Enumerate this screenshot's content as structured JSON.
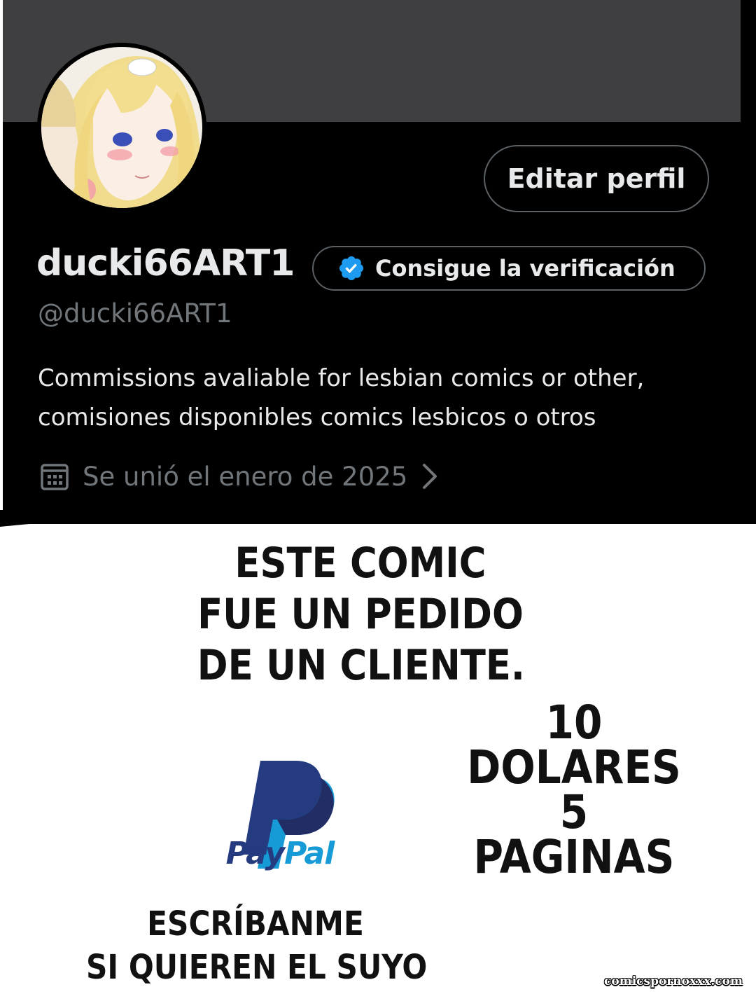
{
  "profile": {
    "display_name": "ducki66ART1",
    "handle": "@ducki66ART1",
    "edit_profile_label": "Editar perfil",
    "verification_label": "Consigue la verificación",
    "bio_lines": [
      "Commissions avaliable for lesbian comics or other,",
      "comisiones disponibles comics lesbicos o otros"
    ],
    "joined_text": "Se unió el enero de 2025",
    "colors": {
      "background": "#000000",
      "banner": "#3f3f42",
      "primary_text": "#e7e9ea",
      "secondary_text": "#71767b",
      "verified_badge": "#1d9bf0"
    },
    "icons": {
      "calendar": "calendar-icon",
      "chevron": "chevron-right-icon",
      "verified": "verified-badge-icon"
    }
  },
  "comic": {
    "main_note": [
      "ESTE COMIC",
      "FUE UN PEDIDO",
      "DE UN CLIENTE."
    ],
    "price_note": [
      "10",
      "DOLARES",
      "5",
      "PAGINAS"
    ],
    "contact_note": [
      "ESCRÍBANME",
      "SI QUIEREN EL SUYO"
    ],
    "paypal": {
      "word_part1": "Pay",
      "word_part2": "Pal",
      "color_dark": "#253b80",
      "color_light": "#179bd7"
    }
  },
  "watermark": "comicspornoxxx.com"
}
